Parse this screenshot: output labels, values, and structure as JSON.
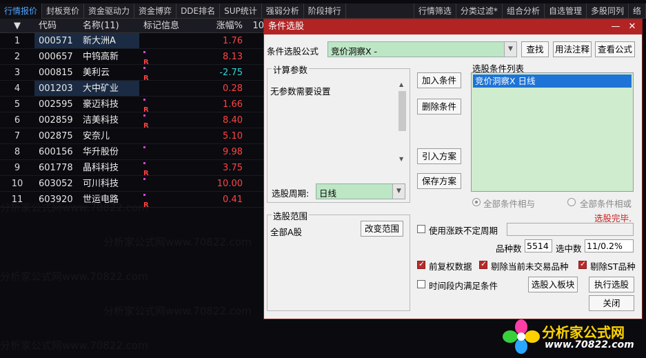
{
  "tabs": [
    "行情报价",
    "封板竞价",
    "资金驱动力",
    "资金博弈",
    "DDE排名",
    "SUP统计",
    "强弱分析",
    "阶段排行",
    "行情筛选",
    "分类过滤*",
    "组合分析",
    "自选管理",
    "多股同列",
    "络"
  ],
  "table": {
    "headers": {
      "sort": "▼",
      "code": "代码",
      "name": "名称(11)",
      "mark": "标记信息",
      "chg": "涨幅%",
      "extra": "10"
    },
    "rows": [
      {
        "idx": "1",
        "code": "000571",
        "name": "新大洲A",
        "mark": "",
        "chg": "1.76",
        "dir": "up"
      },
      {
        "idx": "2",
        "code": "000657",
        "name": "中钨高新",
        "mark": "R",
        "chg": "8.13",
        "dir": "up"
      },
      {
        "idx": "3",
        "code": "000815",
        "name": "美利云",
        "mark": "R",
        "chg": "-2.75",
        "dir": "down"
      },
      {
        "idx": "4",
        "code": "001203",
        "name": "大中矿业",
        "mark": "",
        "chg": "0.28",
        "dir": "up"
      },
      {
        "idx": "5",
        "code": "002595",
        "name": "豪迈科技",
        "mark": "R",
        "chg": "1.66",
        "dir": "up"
      },
      {
        "idx": "6",
        "code": "002859",
        "name": "洁美科技",
        "mark": "R",
        "chg": "8.40",
        "dir": "up"
      },
      {
        "idx": "7",
        "code": "002875",
        "name": "安奈儿",
        "mark": "",
        "chg": "5.10",
        "dir": "up"
      },
      {
        "idx": "8",
        "code": "600156",
        "name": "华升股份",
        "mark": "•",
        "chg": "9.98",
        "dir": "up"
      },
      {
        "idx": "9",
        "code": "601778",
        "name": "晶科科技",
        "mark": "R",
        "chg": "3.75",
        "dir": "up"
      },
      {
        "idx": "10",
        "code": "603052",
        "name": "可川科技",
        "mark": "•",
        "chg": "10.00",
        "dir": "up"
      },
      {
        "idx": "11",
        "code": "603920",
        "name": "世运电路",
        "mark": "R",
        "chg": "0.41",
        "dir": "up"
      }
    ]
  },
  "watermark": "分析家公式网www.70822.com",
  "dialog": {
    "title": "条件选股",
    "formula_label": "条件选股公式",
    "formula_value": "竞价洞察X  -",
    "find_btn": "查找",
    "usage_btn": "用法注释",
    "view_btn": "查看公式",
    "params_title": "计算参数",
    "params_text": "无参数需要设置",
    "add_btn": "加入条件",
    "del_btn": "删除条件",
    "import_btn": "引入方案",
    "save_btn": "保存方案",
    "list_title": "选股条件列表",
    "list_item": "竞价洞察X  日线",
    "period_label": "选股周期:",
    "period_value": "日线",
    "radio_and": "全部条件相与",
    "radio_or": "全部条件相或",
    "status": "选股完毕.",
    "range_title": "选股范围",
    "range_value": "全部A股",
    "change_range_btn": "改变范围",
    "use_period_label": "使用涨跌不定周期",
    "count_label": "品种数",
    "count_value": "5514",
    "selected_label": "选中数",
    "selected_value": "11/0.2%",
    "fq_label": "前复权数据",
    "exclude_untraded_label": "剔除当前未交易品种",
    "exclude_st_label": "剔除ST品种",
    "period_satisfy_label": "时间段内满足条件",
    "to_sector_btn": "选股入板块",
    "run_btn": "执行选股",
    "close_btn": "关闭"
  },
  "logo": {
    "brand": "分析家公式网",
    "url": "www.70822.com"
  }
}
